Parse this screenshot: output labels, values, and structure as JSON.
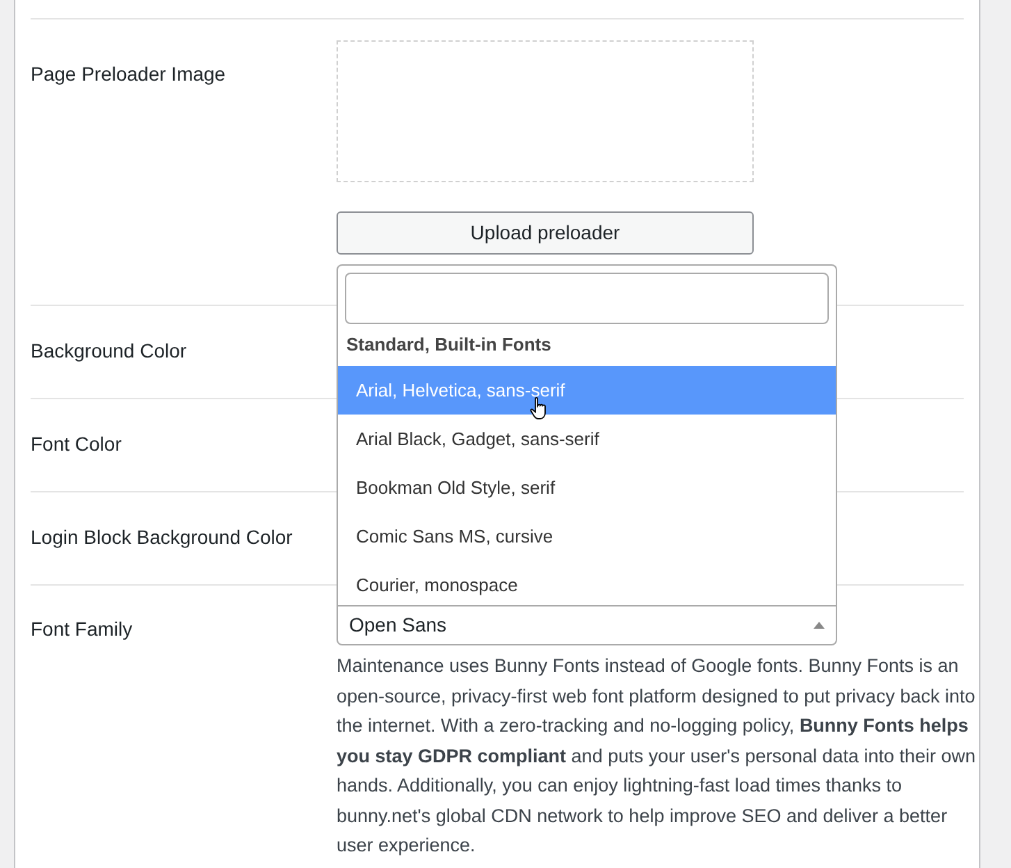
{
  "settings": [
    {
      "kind": "image",
      "label": "Page Preloader Image",
      "button": "Upload preloader"
    },
    {
      "kind": "color",
      "label": "Background Color"
    },
    {
      "kind": "color",
      "label": "Font Color"
    },
    {
      "kind": "color",
      "label": "Login Block Background Color"
    },
    {
      "kind": "font",
      "label": "Font Family",
      "value": "Open Sans",
      "expanded": true,
      "group": "Standard, Built-in Fonts",
      "options": [
        {
          "label": "Arial, Helvetica, sans-serif",
          "selected": true
        },
        {
          "label": "Arial Black, Gadget, sans-serif",
          "selected": false
        },
        {
          "label": "Bookman Old Style, serif",
          "selected": false
        },
        {
          "label": "Comic Sans MS, cursive",
          "selected": false
        },
        {
          "label": "Courier, monospace",
          "selected": false
        }
      ],
      "description": "Maintenance uses Bunny Fonts instead of Google fonts. Bunny Fonts is an open-source, privacy-first web font platform designed to put privacy back into the internet. With a zero-tracking and no-logging policy, **Bunny Fonts helps you stay GDPR compliant** and puts your user's personal data into their own hands. Additionally, you can enjoy lightning-fast load times thanks to bunny.net's global CDN network to help improve SEO and deliver a better user experience."
    }
  ]
}
